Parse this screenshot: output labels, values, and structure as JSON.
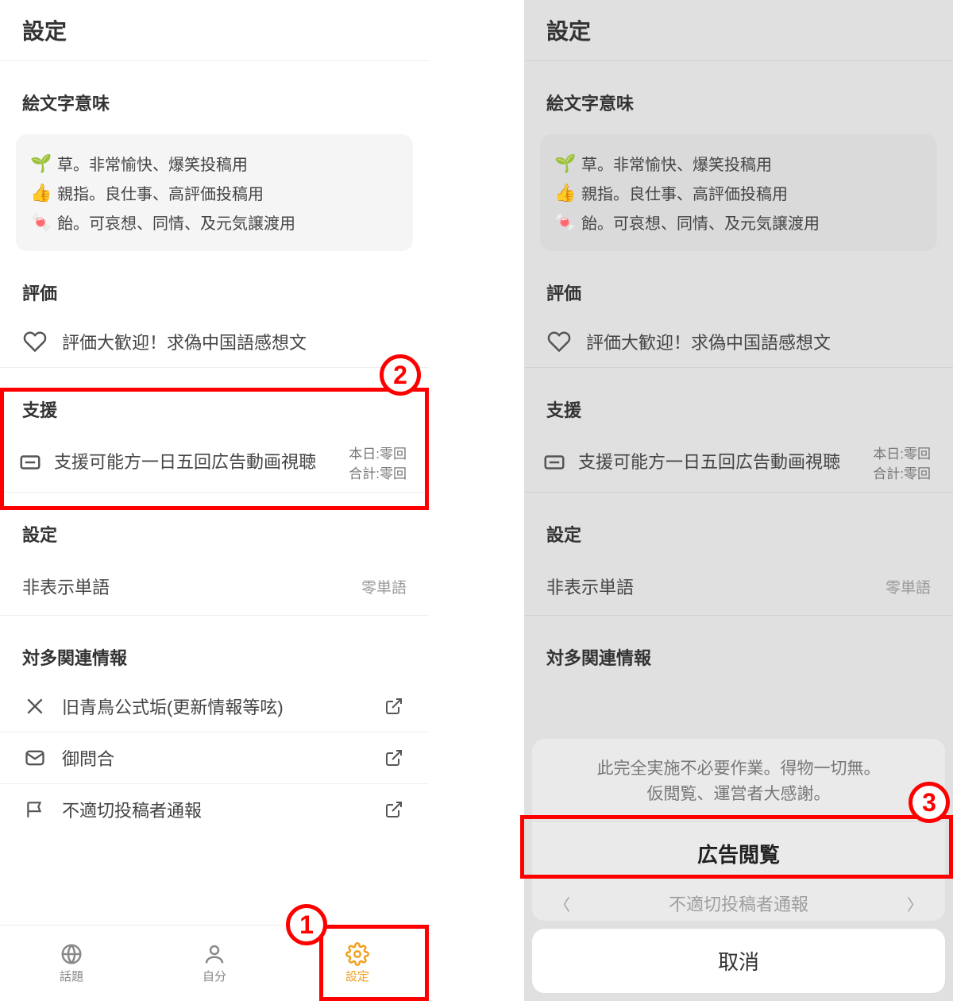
{
  "page_title": "設定",
  "emoji_section": {
    "title": "絵文字意味",
    "items": [
      {
        "emoji": "🌱",
        "text": "草。非常愉快、爆笑投稿用"
      },
      {
        "emoji": "👍",
        "text": "親指。良仕事、高評価投稿用"
      },
      {
        "emoji": "🍬",
        "text": "飴。可哀想、同情、及元気譲渡用"
      }
    ]
  },
  "rating": {
    "title": "評価",
    "row_text": "評価大歓迎！求偽中国語感想文"
  },
  "support": {
    "title": "支援",
    "main_text": "支援可能方一日五回広告動画視聴",
    "today_label": "本日:零回",
    "total_label": "合計:零回"
  },
  "settings": {
    "title": "設定",
    "hidden_words_label": "非表示単語",
    "hidden_words_trail": "零単語"
  },
  "related": {
    "title": "対多関連情報",
    "items": [
      {
        "icon": "x",
        "text": "旧青鳥公式垢(更新情報等呟)"
      },
      {
        "icon": "mail",
        "text": "御問合"
      },
      {
        "icon": "flag",
        "text": "不適切投稿者通報"
      }
    ]
  },
  "nav": {
    "topics": "話題",
    "self": "自分",
    "settings": "設定"
  },
  "sheet": {
    "message_line1": "此完全実施不必要作業。得物一切無。",
    "message_line2": "仮閲覧、運営者大感謝。",
    "action": "広告閲覧",
    "cancel": "取消"
  },
  "annotations": {
    "n1": "1",
    "n2": "2",
    "n3": "3"
  }
}
